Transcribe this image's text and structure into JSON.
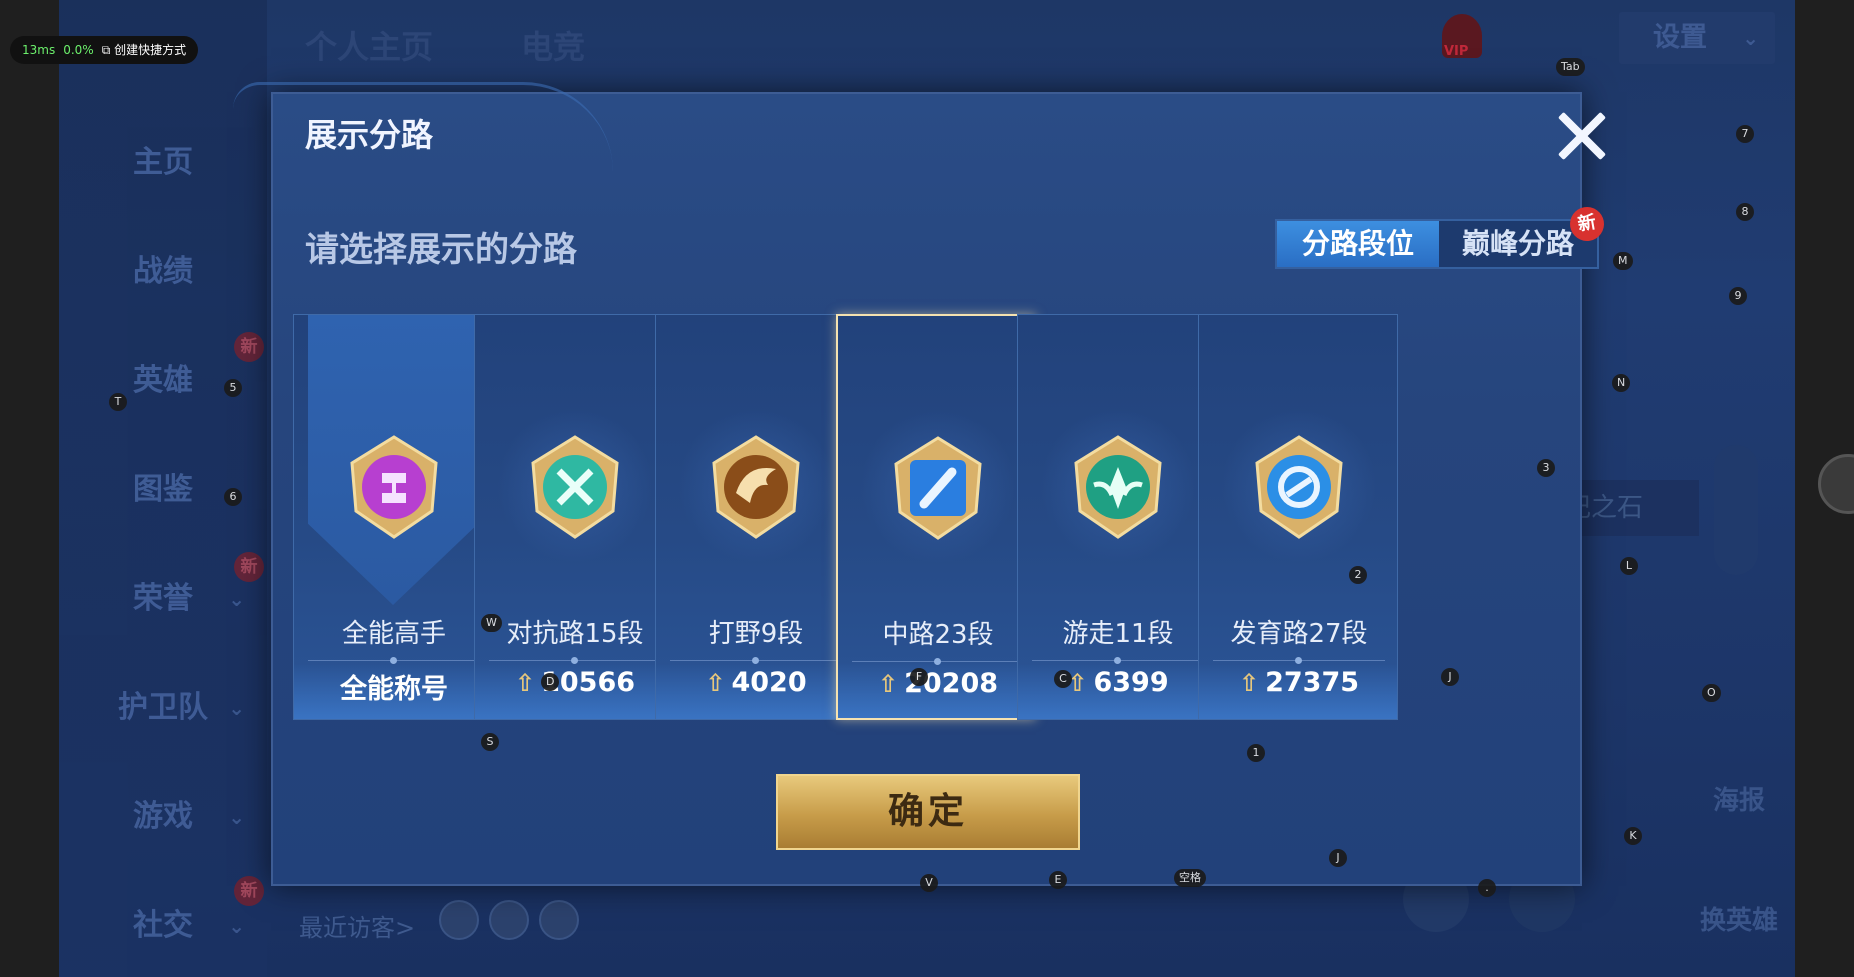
{
  "overlay": {
    "latency": "13ms",
    "cpu": "0.0%",
    "shortcut_label": "创建快捷方式"
  },
  "top": {
    "tab_home": "个人主页",
    "tab_esports": "电竞",
    "settings": "设置",
    "vip": "VIP"
  },
  "sidebar": {
    "items": [
      {
        "label": "主页"
      },
      {
        "label": "战绩"
      },
      {
        "label": "英雄",
        "badge": "新"
      },
      {
        "label": "图鉴"
      },
      {
        "label": "荣誉",
        "badge": "新"
      },
      {
        "label": "护卫队"
      },
      {
        "label": "游戏"
      },
      {
        "label": "社交",
        "badge": "新"
      }
    ]
  },
  "bottom": {
    "recent_visitors": "最近访客>"
  },
  "right_side": {
    "panel_text": "铭记之石",
    "poster": "海报",
    "change_hero": "换英雄"
  },
  "modal": {
    "title": "展示分路",
    "prompt": "请选择展示的分路",
    "segments": [
      "分路段位",
      "巅峰分路"
    ],
    "segment_new_badge": "新",
    "confirm": "确定",
    "cards": [
      {
        "name": "全能高手",
        "score": "全能称号",
        "emblem_color": "#b73fd0"
      },
      {
        "name": "对抗路15段",
        "score": "10566",
        "emblem_color": "#2fb8a2"
      },
      {
        "name": "打野9段",
        "score": "4020",
        "emblem_color": "#b9772a"
      },
      {
        "name": "中路23段",
        "score": "20208",
        "emblem_color": "#2a7ee0"
      },
      {
        "name": "游走11段",
        "score": "6399",
        "emblem_color": "#1fa083"
      },
      {
        "name": "发育路27段",
        "score": "27375",
        "emblem_color": "#2b8fe6"
      }
    ]
  },
  "hotkeys": [
    "Tab",
    "7",
    "8",
    "M",
    "9",
    "N",
    "5",
    "T",
    "6",
    "3",
    "L",
    "2",
    "W",
    "D",
    "F",
    "C",
    "J",
    "S",
    "1",
    "O",
    "K",
    "J",
    "V",
    "E",
    "空格",
    "."
  ]
}
